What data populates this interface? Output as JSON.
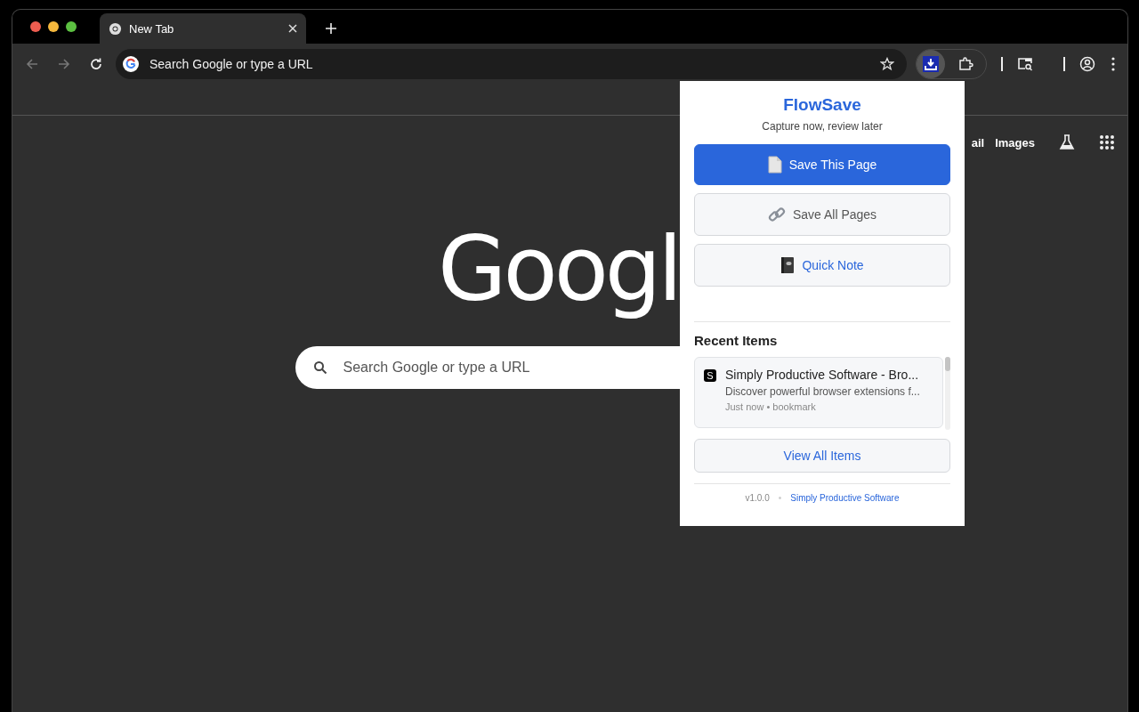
{
  "tabs": [
    {
      "title": "New Tab",
      "selected": true
    }
  ],
  "address_bar": {
    "placeholder": "Search Google or type a URL"
  },
  "ntp": {
    "top_links": [
      "ail",
      "Images"
    ],
    "logo": "Googl",
    "search": {
      "placeholder": "Search Google or type a URL"
    }
  },
  "popup": {
    "title": "FlowSave",
    "subtitle": "Capture now, review later",
    "actions": [
      {
        "kind": "primary",
        "label": "Save This Page"
      },
      {
        "kind": "secondary",
        "label": "Save All Pages"
      },
      {
        "kind": "accent",
        "label": "Quick Note"
      }
    ],
    "recent_heading": "Recent Items",
    "recent_items": [
      {
        "badge": "S",
        "title": "Simply Productive Software - Bro...",
        "description": "Discover powerful browser extensions f...",
        "meta": "Just now • bookmark"
      }
    ],
    "view_all": "View All Items",
    "footer": {
      "version": "v1.0.0",
      "separator": "•",
      "link": "Simply Productive Software"
    }
  }
}
